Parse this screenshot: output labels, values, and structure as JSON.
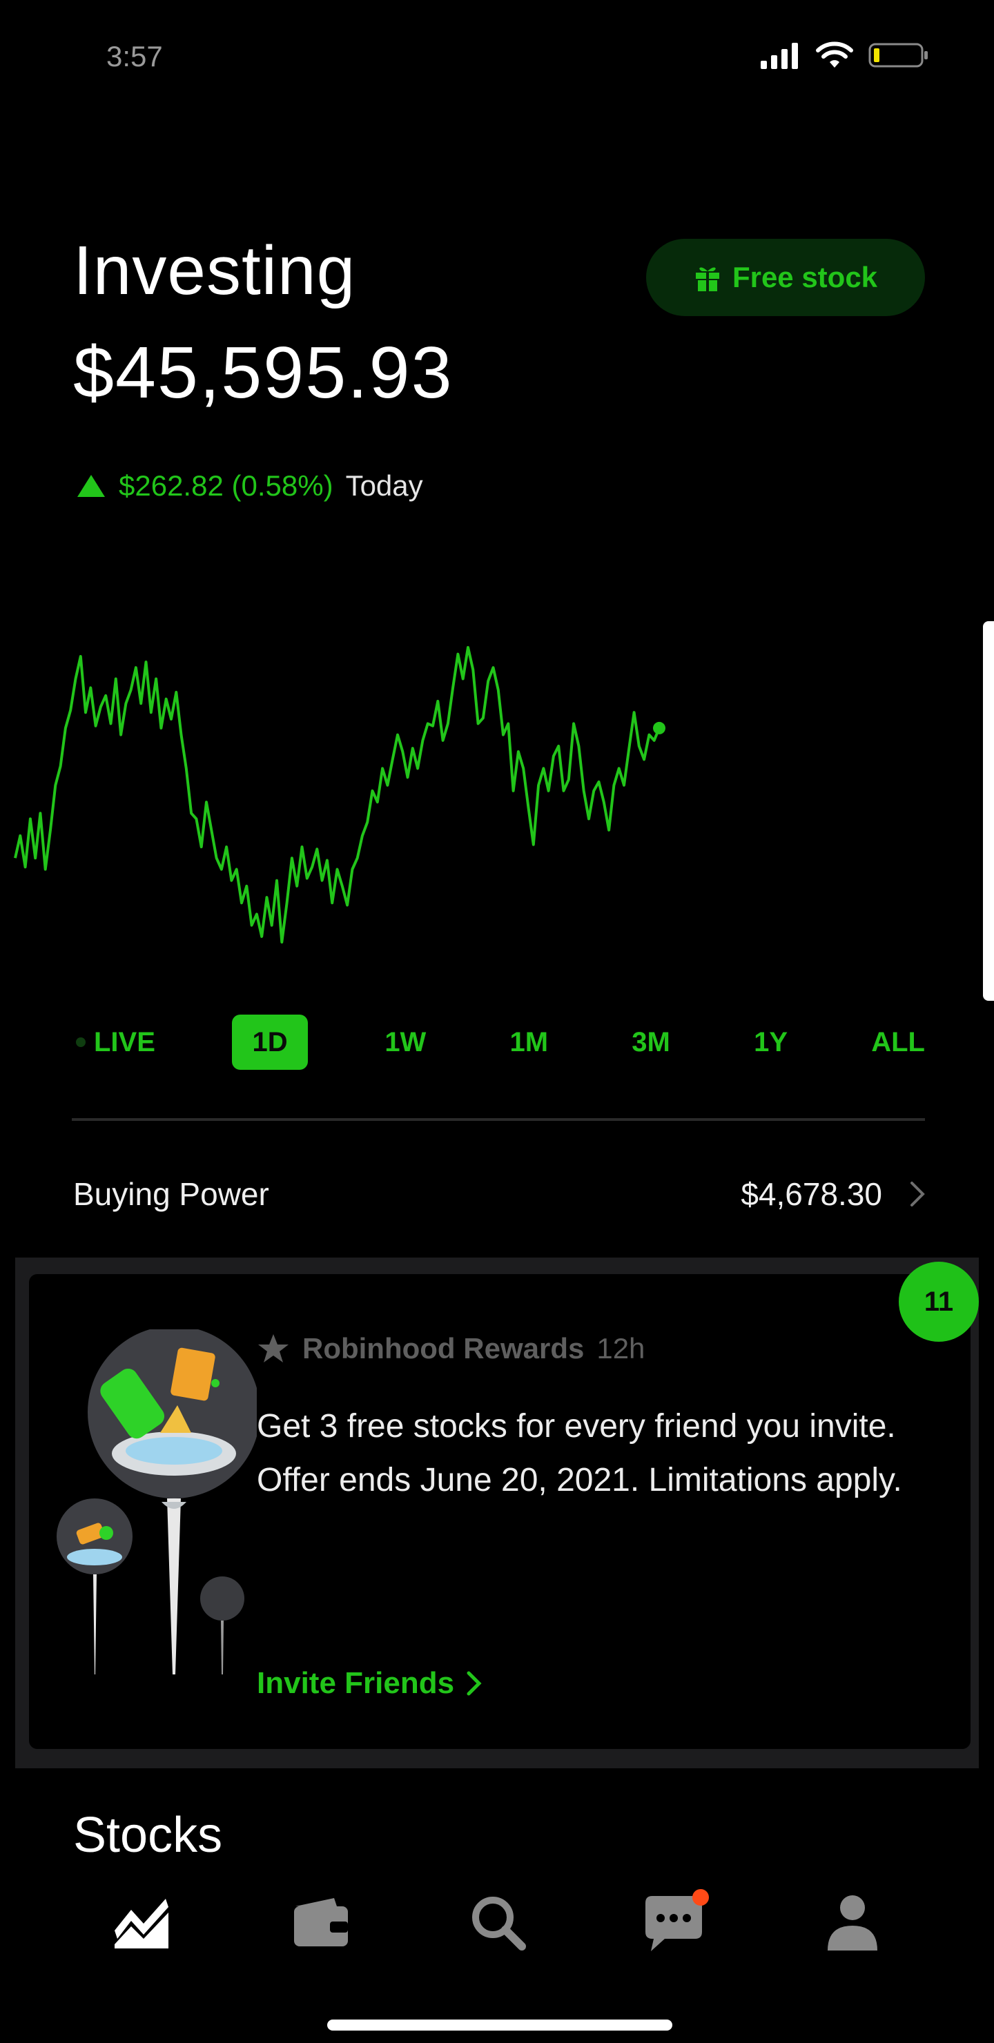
{
  "status_bar": {
    "time": "3:57"
  },
  "header": {
    "title": "Investing",
    "balance": "$45,595.93",
    "free_stock_label": "Free stock",
    "change": "$262.82 (0.58%)",
    "change_period": "Today"
  },
  "chart_data": {
    "type": "line",
    "title": "",
    "xlabel": "",
    "ylabel": "",
    "grid": false,
    "series": [
      {
        "color": "#22c51a",
        "values": [
          45480,
          45500,
          45472,
          45515,
          45480,
          45520,
          45470,
          45505,
          45545,
          45562,
          45596,
          45612,
          45640,
          45660,
          45610,
          45632,
          45598,
          45615,
          45625,
          45600,
          45640,
          45590,
          45618,
          45630,
          45650,
          45618,
          45655,
          45610,
          45640,
          45596,
          45622,
          45604,
          45628,
          45590,
          45560,
          45520,
          45515,
          45490,
          45530,
          45505,
          45480,
          45470,
          45490,
          45460,
          45470,
          45440,
          45455,
          45420,
          45430,
          45410,
          45445,
          45420,
          45460,
          45405,
          45440,
          45480,
          45455,
          45490,
          45462,
          45472,
          45488,
          45460,
          45478,
          45440,
          45470,
          45455,
          45438,
          45470,
          45480,
          45500,
          45512,
          45540,
          45530,
          45560,
          45545,
          45568,
          45590,
          45575,
          45552,
          45578,
          45560,
          45585,
          45600,
          45598,
          45620,
          45585,
          45600,
          45632,
          45662,
          45640,
          45668,
          45648,
          45600,
          45605,
          45638,
          45650,
          45630,
          45590,
          45600,
          45540,
          45575,
          45560,
          45525,
          45492,
          45545,
          45560,
          45540,
          45571,
          45580,
          45540,
          45550,
          45600,
          45580,
          45540,
          45515,
          45540,
          45548,
          45530,
          45505,
          45545,
          45560,
          45545,
          45578,
          45610,
          45580,
          45568,
          45590,
          45585,
          45596
        ]
      }
    ],
    "active_range": "1D"
  },
  "ranges": [
    "LIVE",
    "1D",
    "1W",
    "1M",
    "3M",
    "1Y",
    "ALL"
  ],
  "buying_power": {
    "label": "Buying Power",
    "value": "$4,678.30"
  },
  "rewards_card": {
    "badge_count": "11",
    "source": "Robinhood Rewards",
    "time": "12h",
    "message": "Get 3 free stocks for every friend you invite. Offer ends June 20, 2021. Limitations apply.",
    "cta": "Invite Friends"
  },
  "section_title": "Stocks",
  "nav": {
    "items": [
      "investing-icon",
      "wallet-icon",
      "search-icon",
      "messages-icon",
      "account-icon"
    ]
  },
  "colors": {
    "accent": "#22c51a",
    "background": "#000000",
    "notification": "#ff4a17"
  }
}
